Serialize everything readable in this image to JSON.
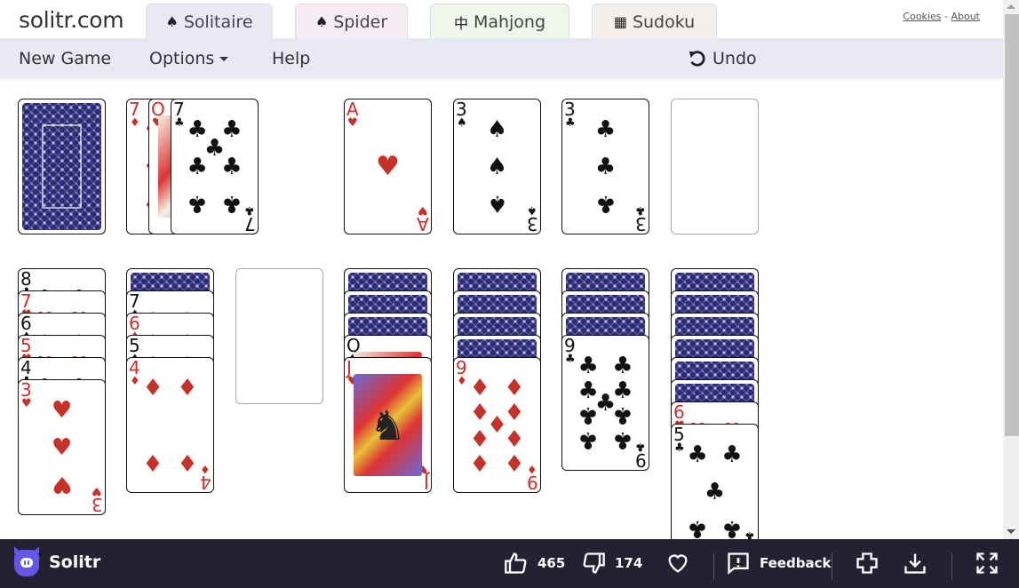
{
  "site": {
    "logo_text": "solitr.com",
    "tabs": [
      {
        "label": "Solitaire",
        "icon": "spade-icon",
        "glyph": "♠",
        "active": true
      },
      {
        "label": "Spider",
        "icon": "spade-icon",
        "glyph": "♠",
        "active": false
      },
      {
        "label": "Mahjong",
        "icon": "mahjong-icon",
        "glyph": "中",
        "active": false
      },
      {
        "label": "Sudoku",
        "icon": "grid-icon",
        "glyph": "▦",
        "active": false
      }
    ],
    "links": {
      "cookies": "Cookies",
      "separator": "-",
      "about": "About"
    }
  },
  "menu": {
    "new_game": "New Game",
    "options": "Options",
    "help": "Help",
    "undo": "Undo"
  },
  "game": {
    "stock": {
      "face_down": true
    },
    "waste": [
      {
        "rank": "7",
        "suit": "diamonds"
      },
      {
        "rank": "Q",
        "suit": "hearts"
      },
      {
        "rank": "7",
        "suit": "clubs"
      }
    ],
    "foundations": [
      {
        "rank": "A",
        "suit": "hearts"
      },
      {
        "rank": "3",
        "suit": "spades"
      },
      {
        "rank": "3",
        "suit": "clubs"
      },
      null
    ],
    "tableau": [
      [
        {
          "rank": "8",
          "suit": "clubs"
        },
        {
          "rank": "7",
          "suit": "hearts"
        },
        {
          "rank": "6",
          "suit": "spades"
        },
        {
          "rank": "5",
          "suit": "hearts"
        },
        {
          "rank": "4",
          "suit": "clubs"
        },
        {
          "rank": "3",
          "suit": "hearts"
        }
      ],
      [
        {
          "down": true
        },
        {
          "rank": "7",
          "suit": "spades"
        },
        {
          "rank": "6",
          "suit": "diamonds"
        },
        {
          "rank": "5",
          "suit": "spades"
        },
        {
          "rank": "4",
          "suit": "diamonds"
        }
      ],
      [],
      [
        {
          "down": true
        },
        {
          "down": true
        },
        {
          "down": true
        },
        {
          "rank": "Q",
          "suit": "spades"
        },
        {
          "rank": "J",
          "suit": "hearts"
        }
      ],
      [
        {
          "down": true
        },
        {
          "down": true
        },
        {
          "down": true
        },
        {
          "down": true
        },
        {
          "rank": "9",
          "suit": "diamonds"
        }
      ],
      [
        {
          "down": true
        },
        {
          "down": true
        },
        {
          "down": true
        },
        {
          "rank": "9",
          "suit": "clubs"
        }
      ],
      [
        {
          "down": true
        },
        {
          "down": true
        },
        {
          "down": true
        },
        {
          "down": true
        },
        {
          "down": true
        },
        {
          "down": true
        },
        {
          "rank": "6",
          "suit": "hearts"
        },
        {
          "rank": "5",
          "suit": "clubs"
        }
      ]
    ]
  },
  "footer": {
    "brand": "Solitr",
    "likes": "465",
    "dislikes": "174",
    "feedback": "Feedback",
    "colors": {
      "bar": "#222233",
      "brand": "#6656e8"
    }
  },
  "colors": {
    "red_suit": "#c8302a",
    "black_suit": "#111111",
    "card_back": "#2b2b7a",
    "menu_bg": "#e9e9f5"
  }
}
